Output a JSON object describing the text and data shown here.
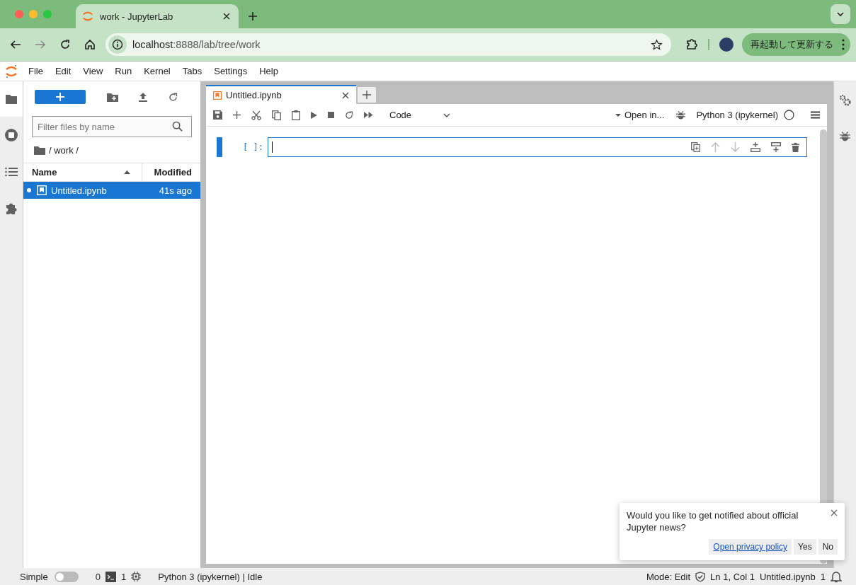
{
  "browser": {
    "tab_title": "work - JupyterLab",
    "url_host": "localhost",
    "url_path": ":8888/lab/tree/work",
    "update_button": "再起動して更新する"
  },
  "menu": [
    "File",
    "Edit",
    "View",
    "Run",
    "Kernel",
    "Tabs",
    "Settings",
    "Help"
  ],
  "file_browser": {
    "filter_placeholder": "Filter files by name",
    "breadcrumb": "/ work /",
    "columns": [
      "Name",
      "Modified"
    ],
    "rows": [
      {
        "name": "Untitled.ipynb",
        "modified": "41s ago",
        "selected": true,
        "running": true
      }
    ]
  },
  "notebook": {
    "tabs": [
      {
        "title": "Untitled.ipynb",
        "selected": true
      }
    ],
    "cell_type": "Code",
    "open_in": "Open in...",
    "kernel": "Python 3 (ipykernel)",
    "cell_prompt": "[ ]:"
  },
  "notification": {
    "message": "Would you like to get notified about official Jupyter news?",
    "link": "Open privacy policy",
    "buttons": [
      "Yes",
      "No"
    ]
  },
  "status_bar": {
    "simple_label": "Simple",
    "simple_on": false,
    "terminals": "0",
    "kernels": "1",
    "kernel_status": "Python 3 (ipykernel) | Idle",
    "mode": "Mode: Edit",
    "position": "Ln 1, Col 1",
    "file": "Untitled.ipynb",
    "notifications": "1"
  }
}
